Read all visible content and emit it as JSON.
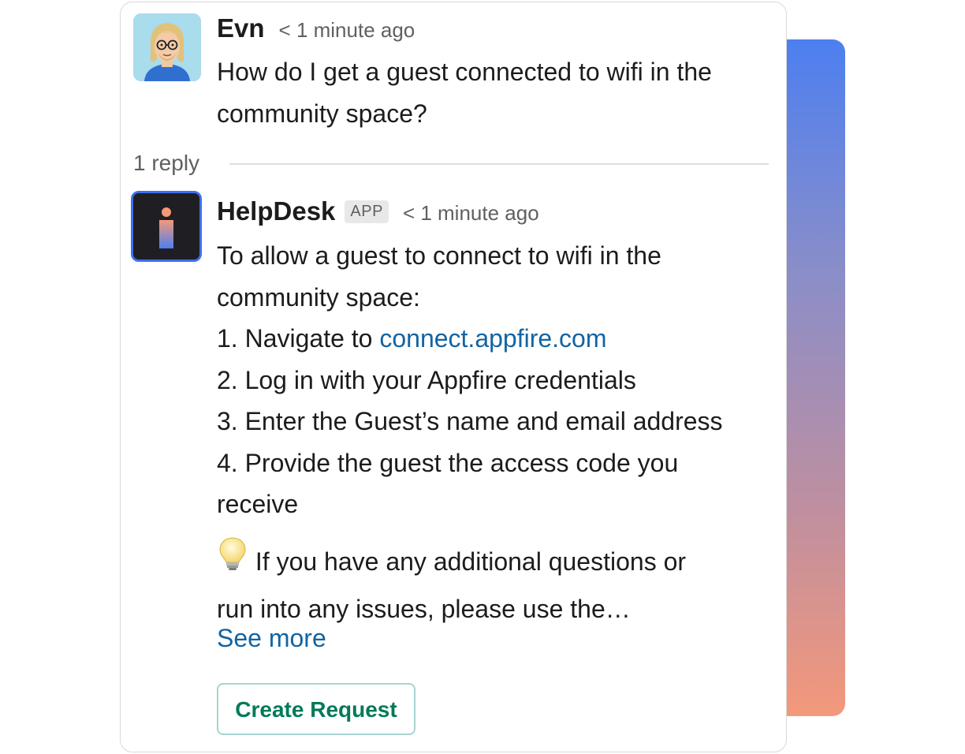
{
  "thread": {
    "parent": {
      "sender": "Evn",
      "timestamp": "< 1 minute ago",
      "text_lines": [
        "How do I get a guest connected to wifi in the",
        "community space?"
      ]
    },
    "reply_count": "1 reply",
    "reply": {
      "sender": "HelpDesk",
      "badge": "APP",
      "timestamp": "< 1 minute ago",
      "intro_lines": [
        "To allow a guest to connect to wifi in the",
        "community space:"
      ],
      "step1_prefix": "1. Navigate to ",
      "step1_link": "connect.appfire.com",
      "step2": "2. Log in with your Appfire credentials",
      "step3": "3. Enter the Guest’s name and email address",
      "step4_lines": [
        "4. Provide the guest the access code you",
        "receive"
      ],
      "tip_icon": "lightbulb-icon",
      "tip_lines": [
        " If you have any additional questions or",
        "run into any issues, please use the…"
      ],
      "see_more": "See more",
      "button_label": "Create Request"
    }
  },
  "colors": {
    "link": "#1264a3",
    "button_text": "#007a5a",
    "gradient_top": "#4d7ff0",
    "gradient_bottom": "#f4987a"
  }
}
